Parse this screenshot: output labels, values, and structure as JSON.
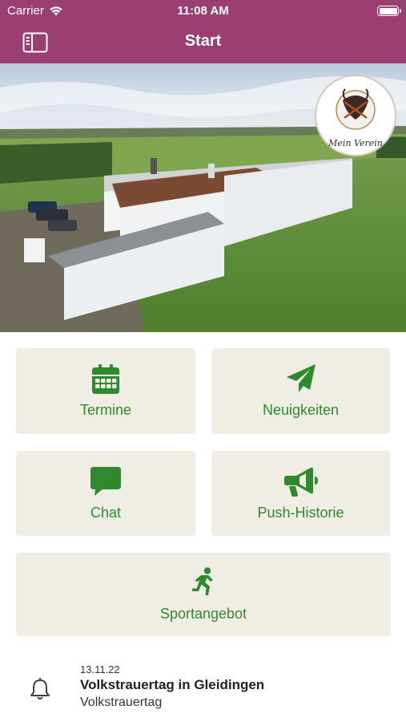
{
  "status_bar": {
    "carrier": "Carrier",
    "time": "11:08 AM"
  },
  "nav": {
    "title": "Start"
  },
  "hero": {
    "logo_text": "Mein Verein"
  },
  "tiles": [
    {
      "label": "Termine",
      "icon": "calendar-icon"
    },
    {
      "label": "Neuigkeiten",
      "icon": "paper-plane-icon"
    },
    {
      "label": "Chat",
      "icon": "chat-bubble-icon"
    },
    {
      "label": "Push-Historie",
      "icon": "megaphone-icon"
    },
    {
      "label": "Sportangebot",
      "icon": "running-person-icon"
    }
  ],
  "news": {
    "date": "13.11.22",
    "title": "Volkstrauertag in Gleidingen",
    "subtitle": "Volkstrauertag"
  },
  "colors": {
    "header": "#9b3e72",
    "tile_bg": "#efede4",
    "accent_green": "#2f8a2f"
  }
}
